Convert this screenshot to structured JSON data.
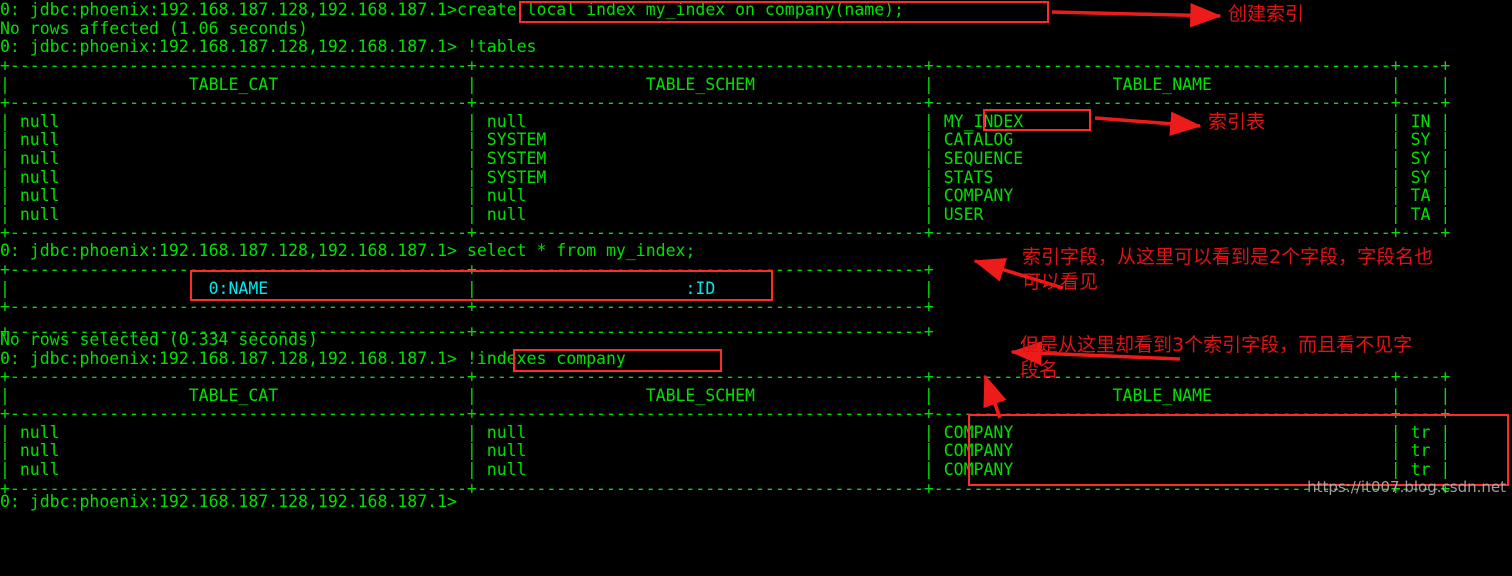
{
  "terminal": {
    "prompt": "0: jdbc:phoenix:192.168.187.128,192.168.187.1>",
    "lines": {
      "l1_cmd": "create local index my_index on company(name);",
      "l2": "No rows affected (1.06 seconds)",
      "l3_cmd": "!tables",
      "l_select_cmd": "select * from my_index;",
      "l_no_rows_selected": "No rows selected (0.334 seconds)",
      "l_indexes_cmd": "!indexes company",
      "l_final_prompt": "0: jdbc:phoenix:192.168.187.128,192.168.187.1>"
    }
  },
  "tables": {
    "tables_result": {
      "headers": [
        "TABLE_CAT",
        "TABLE_SCHEM",
        "TABLE_NAME",
        ""
      ],
      "rows": [
        [
          "null",
          "null",
          "MY_INDEX",
          "IN"
        ],
        [
          "null",
          "SYSTEM",
          "CATALOG",
          "SY"
        ],
        [
          "null",
          "SYSTEM",
          "SEQUENCE",
          "SY"
        ],
        [
          "null",
          "SYSTEM",
          "STATS",
          "SY"
        ],
        [
          "null",
          "null",
          "COMPANY",
          "TA"
        ],
        [
          "null",
          "null",
          "USER",
          "TA"
        ]
      ]
    },
    "select_result": {
      "headers": [
        "0:NAME",
        ":ID"
      ],
      "rows": []
    },
    "indexes_result": {
      "headers": [
        "TABLE_CAT",
        "TABLE_SCHEM",
        "TABLE_NAME",
        ""
      ],
      "rows": [
        [
          "null",
          "null",
          "COMPANY",
          "tr"
        ],
        [
          "null",
          "null",
          "COMPANY",
          "tr"
        ],
        [
          "null",
          "null",
          "COMPANY",
          "tr"
        ]
      ]
    }
  },
  "annotations": {
    "note_create_index": "创建索引",
    "note_index_table": "索引表",
    "note_index_fields": "索引字段，从这里可以看到是2个字段，字段名也\n可以看见",
    "note_three_fields": "但是从这里却看到3个索引字段，而且看不见字\n段名"
  },
  "watermark": "https://it007.blog.csdn.net",
  "colors": {
    "terminal_green": "#00e000",
    "cyan_header": "#00e8f0",
    "annotation_red": "#e01212",
    "box_red": "#ff2a2a",
    "background": "#000000"
  }
}
